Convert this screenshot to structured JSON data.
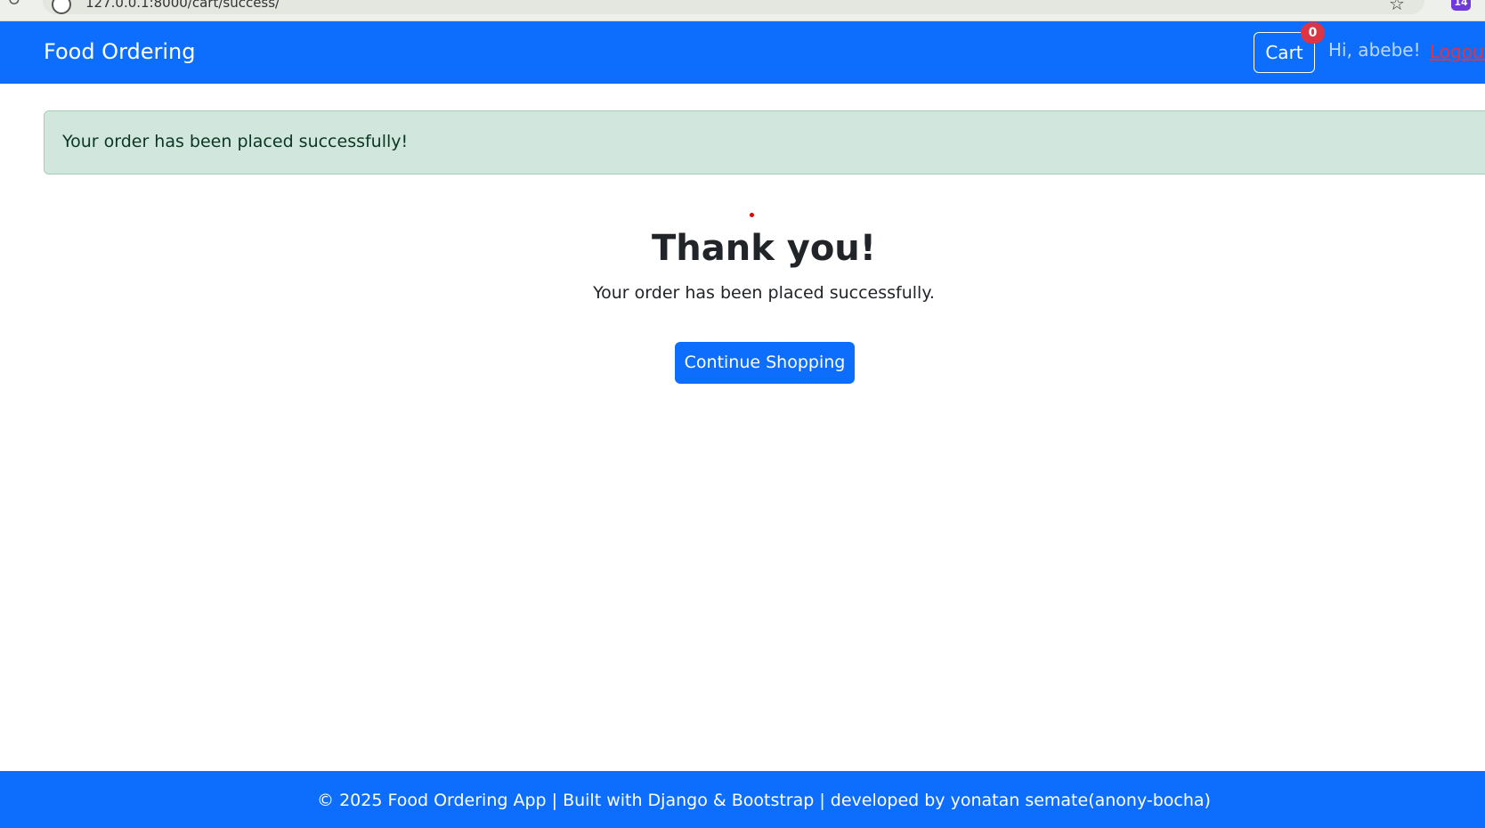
{
  "browser": {
    "url": "127.0.0.1:8000/cart/success/",
    "extension_badge": "14"
  },
  "navbar": {
    "brand": "Food Ordering",
    "cart_label": "Cart",
    "cart_count": "0",
    "greeting": "Hi, abebe!",
    "logout_label": "Logout"
  },
  "alert": {
    "message": "Your order has been placed successfully!",
    "type": "success"
  },
  "main": {
    "title": "Thank you!",
    "subtitle": "Your order has been placed successfully.",
    "continue_label": "Continue Shopping"
  },
  "footer": {
    "text": "© 2025 Food Ordering App | Built with Django & Bootstrap | developed by yonatan semate(anony-bocha)"
  },
  "colors": {
    "primary": "#0d6efd",
    "danger": "#dc3545",
    "success_bg": "#d1e7dd",
    "success_text": "#0a3622"
  }
}
